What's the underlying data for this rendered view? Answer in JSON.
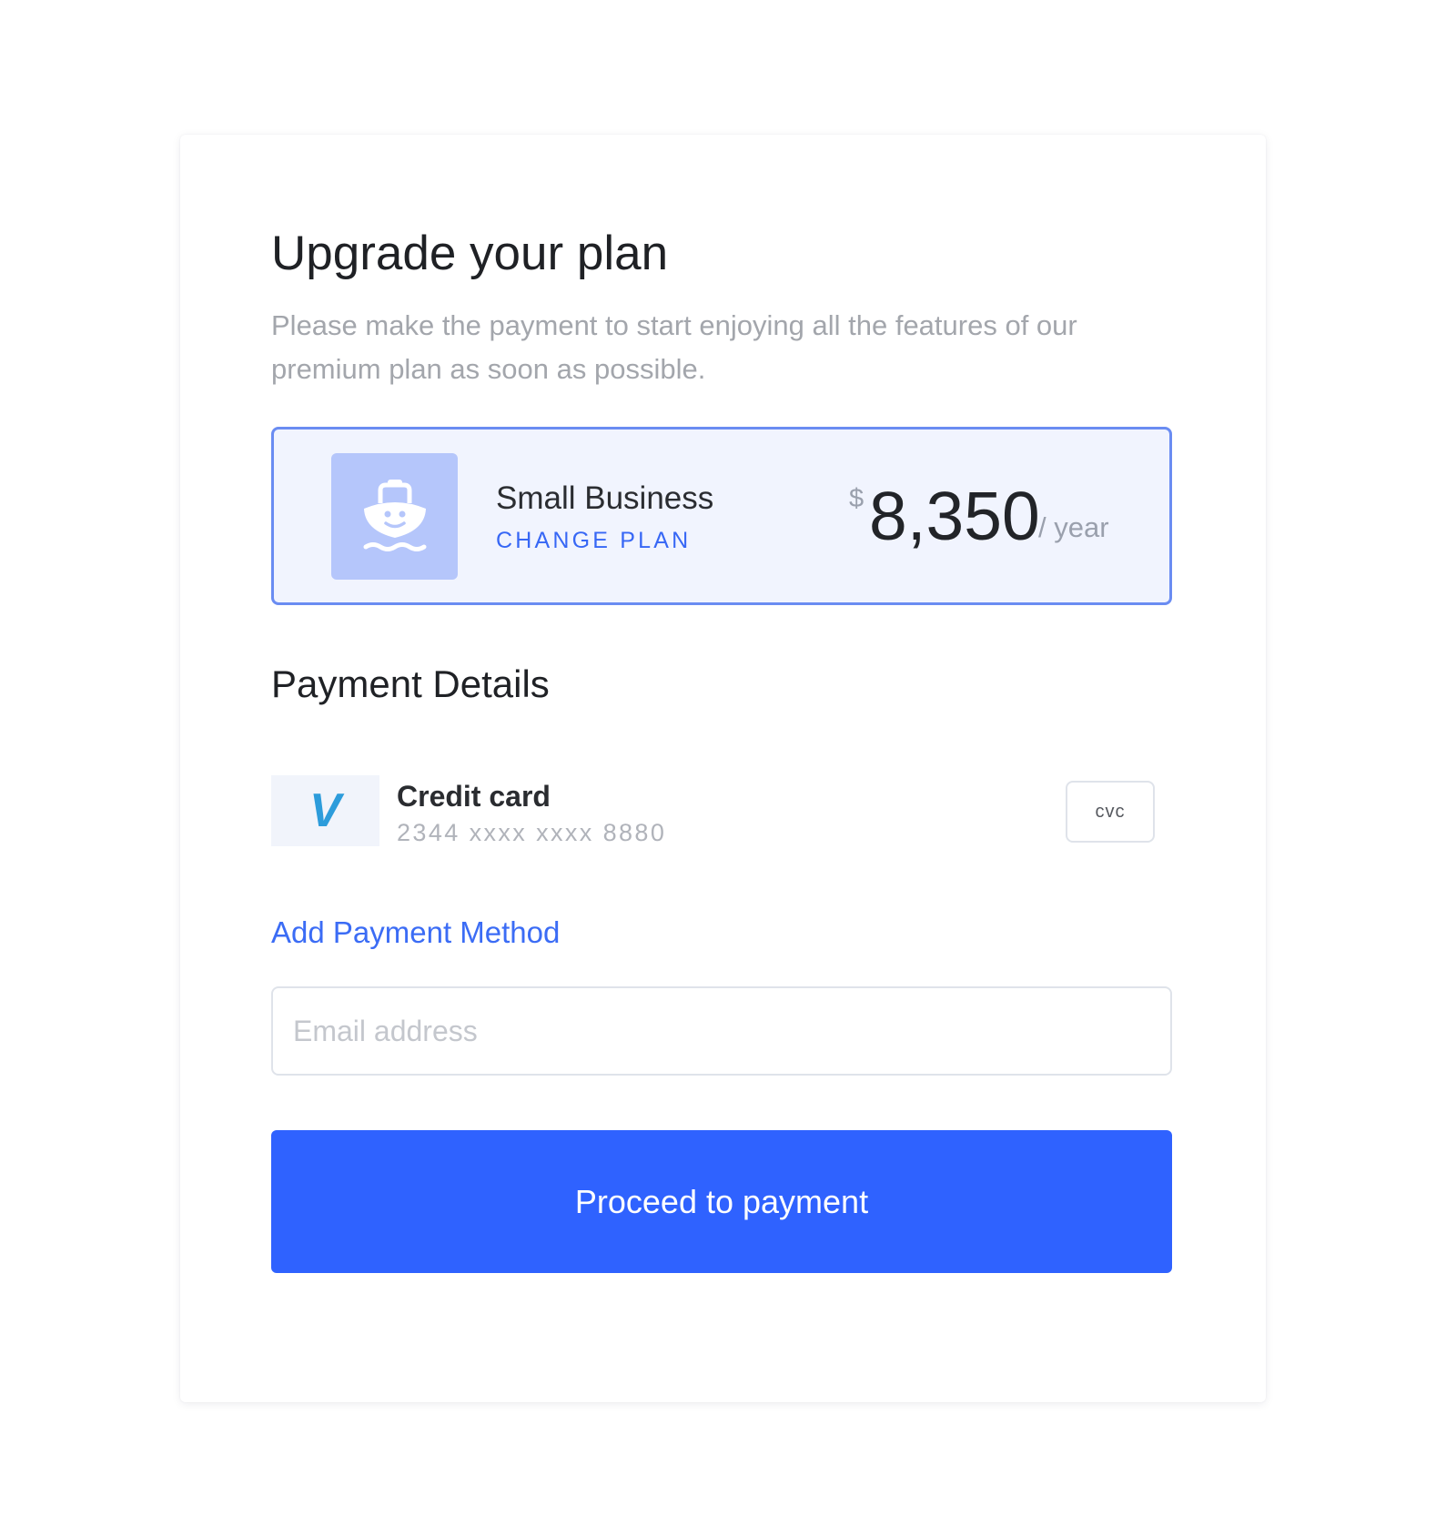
{
  "header": {
    "title": "Upgrade your plan",
    "subtitle": "Please make the payment to start enjoying all the features of our premium plan as soon as possible."
  },
  "plan": {
    "icon": "ship-icon",
    "name": "Small Business",
    "change_label": "CHANGE PLAN",
    "currency": "$",
    "price": "8,350",
    "period": "/ year"
  },
  "payment": {
    "section_title": "Payment Details",
    "method": {
      "logo_letter": "V",
      "name": "Credit card",
      "number": "2344 xxxx xxxx 8880",
      "cvc_placeholder": "cvc"
    },
    "add_method_label": "Add Payment Method"
  },
  "email": {
    "placeholder": "Email address",
    "value": ""
  },
  "cta": {
    "label": "Proceed to payment"
  },
  "colors": {
    "accent": "#2f62ff",
    "link": "#3b6cf5",
    "plan_border": "#6a8cf2",
    "plan_background": "#f1f4fe",
    "icon_background": "#b5c6fb",
    "card_logo": "#2d9cdb"
  }
}
